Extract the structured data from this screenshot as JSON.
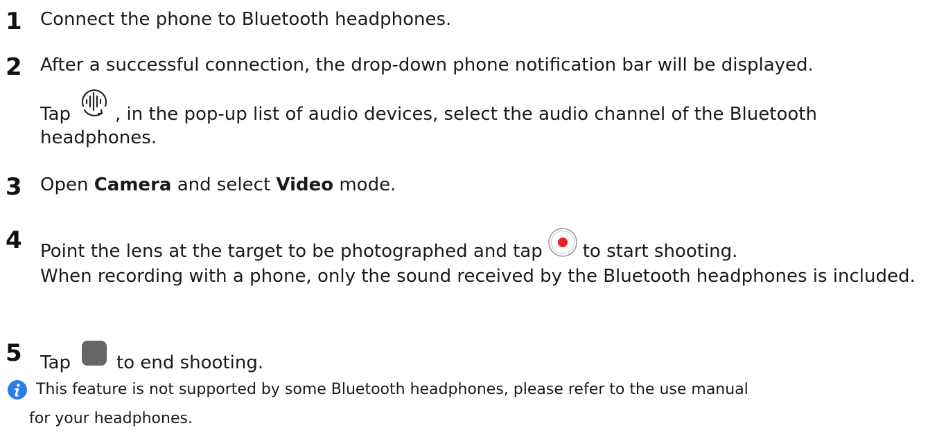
{
  "steps": [
    {
      "number": "1",
      "text": "Connect the phone to Bluetooth headphones."
    },
    {
      "number": "2",
      "text": "After a successful connection, the drop-down phone notification bar will be displayed.",
      "tap_prefix": "Tap",
      "tap_suffix": ", in the pop-up list of audio devices, select the audio channel of the Bluetooth headphones.",
      "icon": "audio-channel-icon"
    },
    {
      "number": "3",
      "pre": "Open",
      "bold1": "Camera",
      "mid": "and select",
      "bold2": "Video",
      "post": "mode."
    },
    {
      "number": "4",
      "pre": "Point the lens at the target to be photographed and tap",
      "post": "to start shooting.",
      "line2": "When recording with a phone, only the sound received by the Bluetooth headphones is included.",
      "icon": "record-button-icon"
    },
    {
      "number": "5",
      "pre": "Tap",
      "post": "to end shooting.",
      "icon": "stop-button-icon"
    }
  ],
  "note": {
    "icon": "info-icon",
    "line1": "This feature is not supported by some Bluetooth headphones, please refer to the use manual",
    "line2": "for your headphones."
  },
  "colors": {
    "record_red": "#e8202a",
    "stop_gray": "#666666",
    "info_blue": "#2b7de9"
  }
}
